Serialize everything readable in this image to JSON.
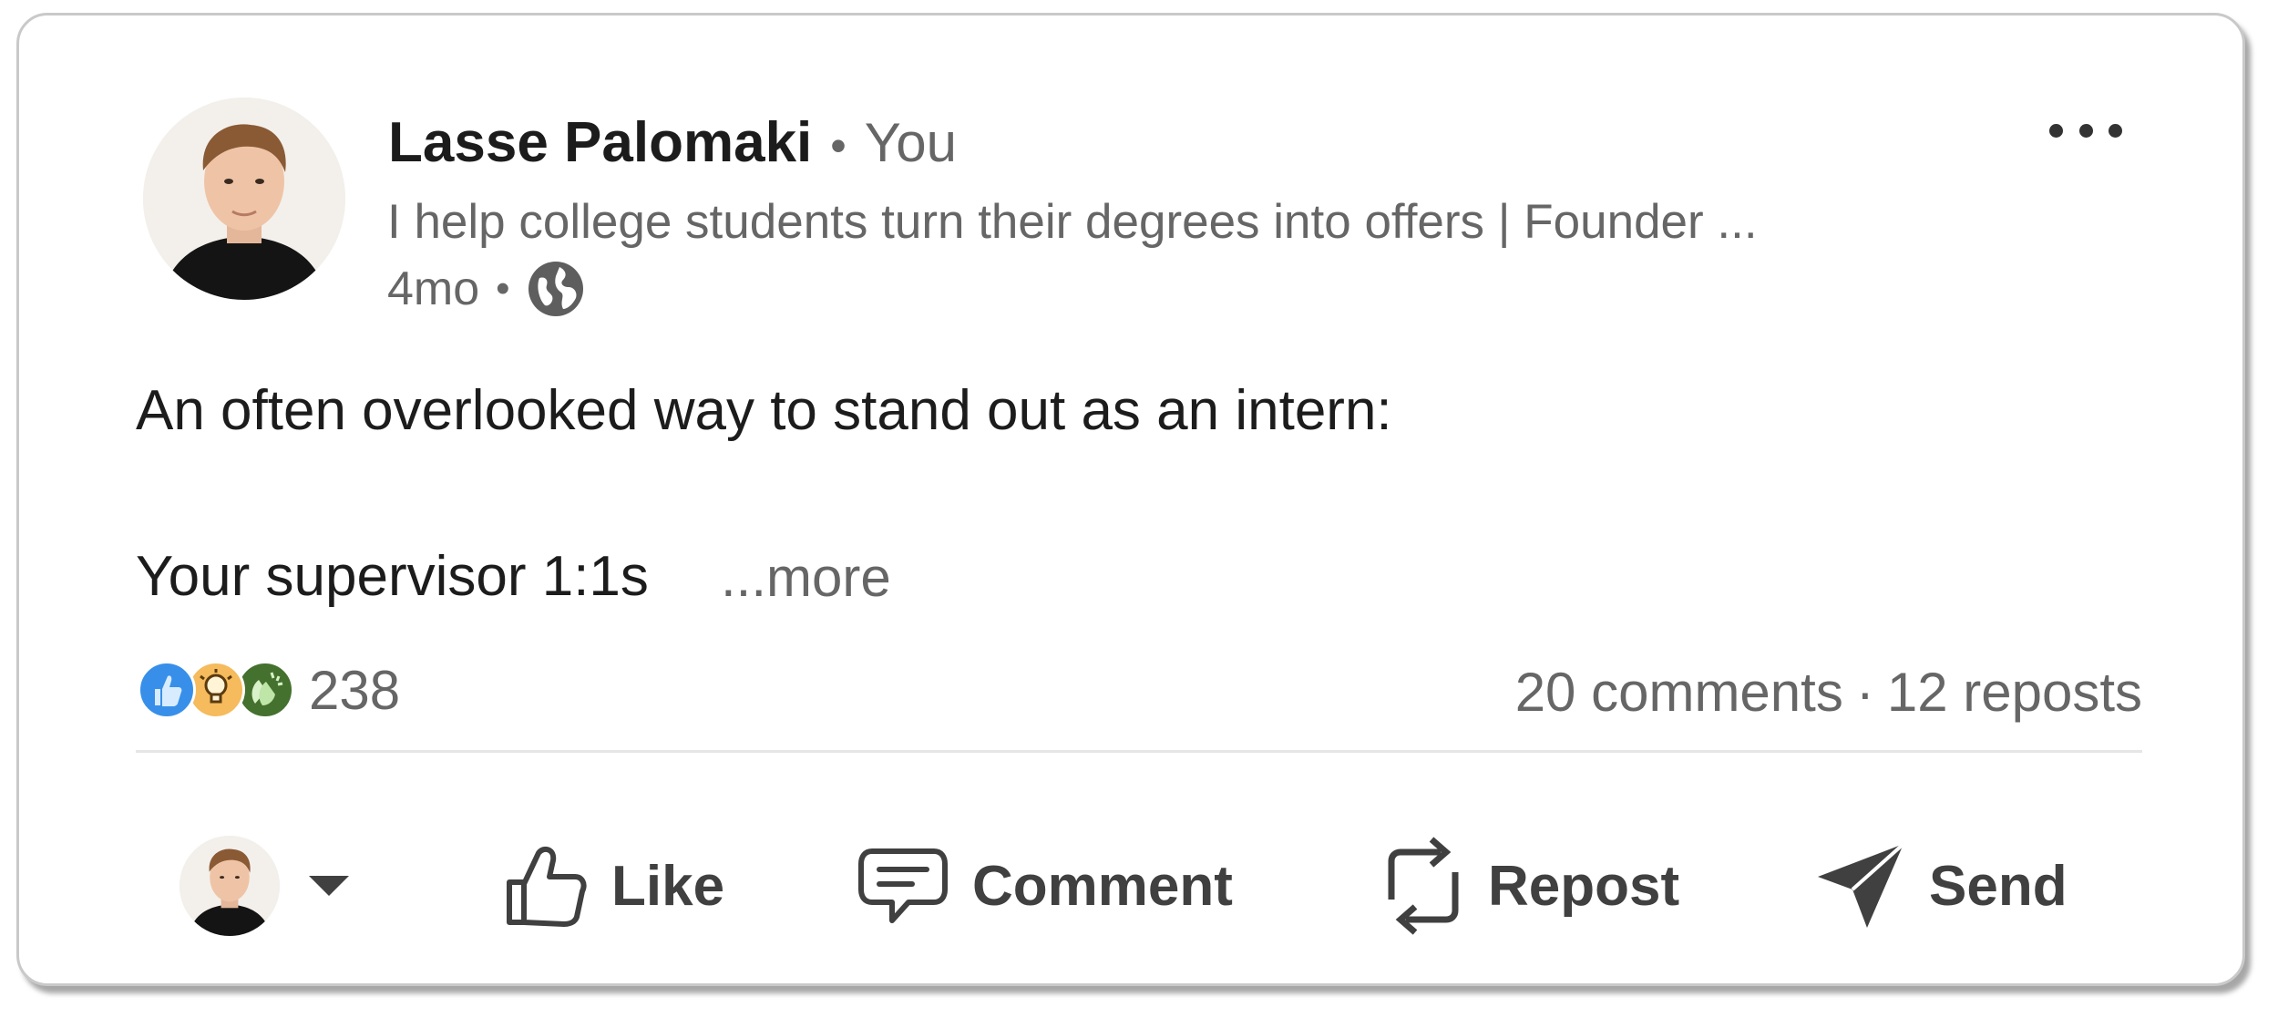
{
  "author": {
    "name": "Lasse Palomaki",
    "relation": "You",
    "headline": "I help college students turn their degrees into offers | Founder ...",
    "time": "4mo",
    "visibility_icon": "globe-icon"
  },
  "post": {
    "line1": "An often overlooked way to stand out as an intern:",
    "line2": "Your supervisor 1:1s",
    "see_more": "...more"
  },
  "social": {
    "reaction_icons": [
      "like-icon",
      "insightful-icon",
      "celebrate-icon"
    ],
    "reaction_count": "238",
    "comments": "20 comments",
    "separator": "·",
    "reposts": "12 reposts"
  },
  "actions": {
    "like": "Like",
    "comment": "Comment",
    "repost": "Repost",
    "send": "Send"
  },
  "colors": {
    "like_blue": "#378fe9",
    "insightful_orange": "#f5bb5c",
    "celebrate_green": "#44712e",
    "text_primary": "#1c1c1c",
    "text_secondary": "#666666",
    "action_gray": "#404040"
  }
}
